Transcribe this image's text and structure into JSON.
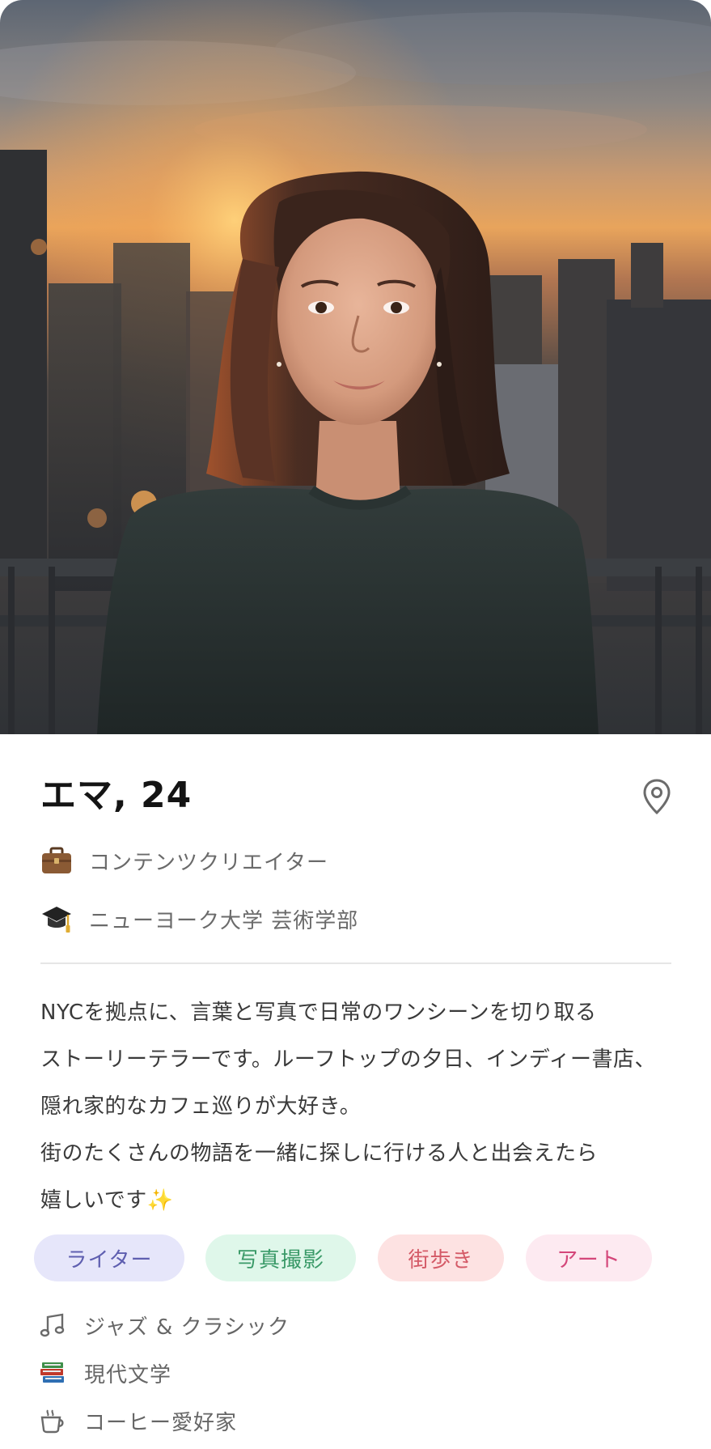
{
  "profile": {
    "name_age": "エマ, 24",
    "job": "コンテンツクリエイター",
    "school": "ニューヨーク大学 芸術学部",
    "bio_lines": [
      "NYCを拠点に、言葉と写真で日常のワンシーンを切り取る",
      "ストーリーテラーです。ルーフトップの夕日、インディー書店、",
      "隠れ家的なカフェ巡りが大好き。",
      "街のたくさんの物語を一緒に探しに行ける人と出会えたら",
      "嬉しいです✨"
    ]
  },
  "icons": {
    "location": "map-pin-icon",
    "job": "briefcase-icon",
    "school": "graduation-cap-icon",
    "music": "music-note-icon",
    "books": "books-icon",
    "coffee": "coffee-cup-icon"
  },
  "tags": [
    {
      "label": "ライター",
      "bg": "#e6e6fa",
      "color": "#5f5fb0"
    },
    {
      "label": "写真撮影",
      "bg": "#dff7ea",
      "color": "#3a9a68"
    },
    {
      "label": "街歩き",
      "bg": "#fde2e2",
      "color": "#d45a67"
    },
    {
      "label": "アート",
      "bg": "#fdeaf1",
      "color": "#d4477a"
    }
  ],
  "likes": [
    {
      "label": "ジャズ & クラシック",
      "icon": "music-note-icon"
    },
    {
      "label": "現代文学",
      "icon": "books-icon"
    },
    {
      "label": "コーヒー愛好家",
      "icon": "coffee-cup-icon"
    }
  ],
  "colors": {
    "accent_name": "#141414",
    "secondary_text": "#6a6a6a",
    "divider": "#e6e6e6"
  }
}
